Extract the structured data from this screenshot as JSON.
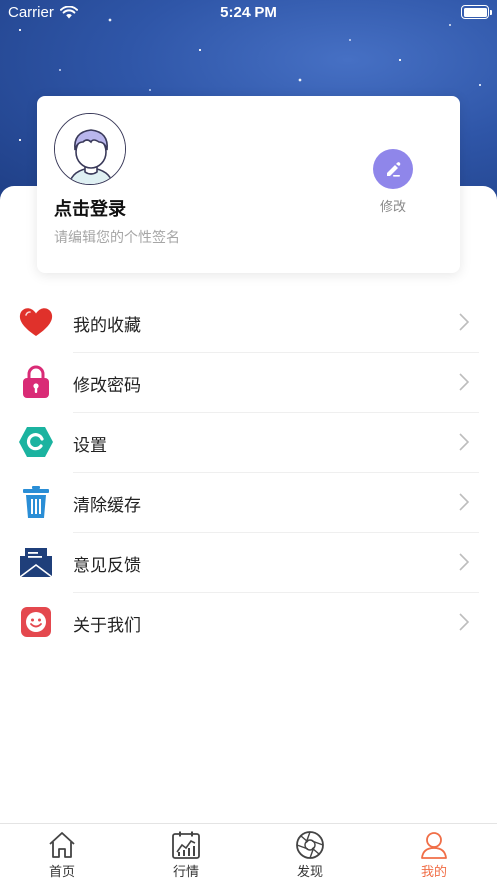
{
  "status_bar": {
    "carrier": "Carrier",
    "time": "5:24 PM"
  },
  "profile": {
    "login_text": "点击登录",
    "signature_placeholder": "请编辑您的个性签名",
    "edit_label": "修改"
  },
  "menu": {
    "items": [
      {
        "label": "我的收藏",
        "icon": "heart-icon",
        "color": "#e0312b"
      },
      {
        "label": "修改密码",
        "icon": "lock-icon",
        "color": "#d92b76"
      },
      {
        "label": "设置",
        "icon": "settings-hexagon-icon",
        "color": "#1bb3a0"
      },
      {
        "label": "清除缓存",
        "icon": "trash-icon",
        "color": "#2a8ed6"
      },
      {
        "label": "意见反馈",
        "icon": "envelope-icon",
        "color": "#1f3f7a"
      },
      {
        "label": "关于我们",
        "icon": "smiley-icon",
        "color": "#e4484e"
      }
    ]
  },
  "tab_bar": {
    "tabs": [
      {
        "label": "首页",
        "icon": "home-icon",
        "active": false
      },
      {
        "label": "行情",
        "icon": "market-chart-icon",
        "active": false
      },
      {
        "label": "发现",
        "icon": "discover-icon",
        "active": false
      },
      {
        "label": "我的",
        "icon": "user-icon",
        "active": true
      }
    ],
    "active_color": "#f06e47"
  }
}
